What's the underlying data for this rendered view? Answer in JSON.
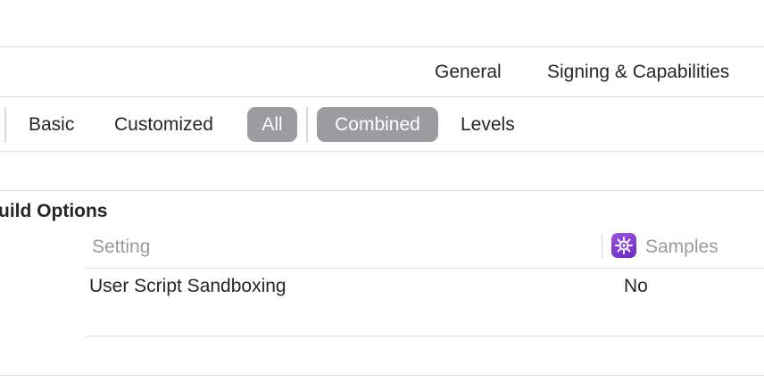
{
  "top_tabs": [
    "General",
    "Signing & Capabilities"
  ],
  "filter_bar": {
    "scope": [
      "Basic",
      "Customized",
      "All"
    ],
    "scope_selected": "All",
    "view": [
      "Combined",
      "Levels"
    ],
    "view_selected": "Combined"
  },
  "section": {
    "title": "uild Options"
  },
  "table": {
    "columns": [
      "Setting",
      "Samples"
    ],
    "target_icon": "target-gear-icon",
    "target_color": "#7b3fd0",
    "rows": [
      {
        "setting": "User Script Sandboxing",
        "value": "No"
      }
    ]
  }
}
